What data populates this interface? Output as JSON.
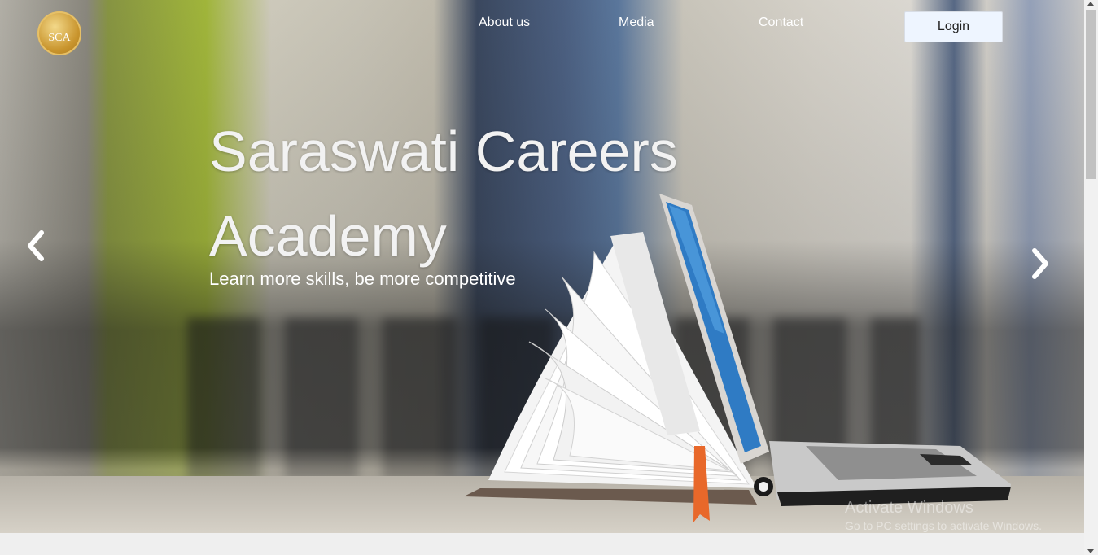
{
  "logo": {
    "text": "SCA"
  },
  "nav": {
    "about": "About us",
    "media": "Media",
    "contact": "Contact",
    "login": "Login"
  },
  "hero": {
    "title": "Saraswati Careers Academy",
    "subtitle": "Learn more skills, be more competitive"
  },
  "carousel": {
    "prev_icon": "chevron-left-icon",
    "next_icon": "chevron-right-icon"
  },
  "watermark": {
    "title": "Activate Windows",
    "subtitle": "Go to PC settings to activate Windows."
  },
  "colors": {
    "login_bg": "#eef5ff",
    "nav_text": "#ffffff",
    "footer_bg": "#efefef"
  }
}
